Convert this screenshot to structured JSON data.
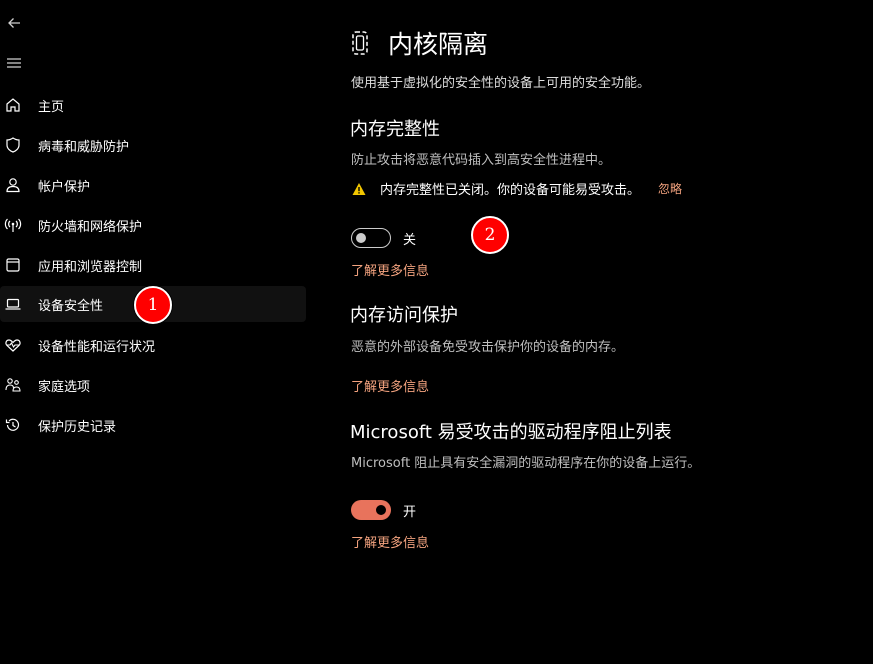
{
  "sidebar": {
    "back_icon": "back-arrow-icon",
    "menu_icon": "hamburger-menu-icon",
    "items": [
      {
        "label": "主页",
        "icon": "home-icon"
      },
      {
        "label": "病毒和威胁防护",
        "icon": "shield-icon"
      },
      {
        "label": "帐户保护",
        "icon": "person-icon"
      },
      {
        "label": "防火墙和网络保护",
        "icon": "wireless-signal-icon"
      },
      {
        "label": "应用和浏览器控制",
        "icon": "app-window-icon"
      },
      {
        "label": "设备安全性",
        "icon": "laptop-icon",
        "selected": true
      },
      {
        "label": "设备性能和运行状况",
        "icon": "heart-pulse-icon"
      },
      {
        "label": "家庭选项",
        "icon": "family-icon"
      },
      {
        "label": "保护历史记录",
        "icon": "history-clock-icon"
      }
    ]
  },
  "annotations": {
    "badge_1": "1",
    "badge_2": "2"
  },
  "main": {
    "title_icon": "core-isolation-chip-icon",
    "title": "内核隔离",
    "subtitle": "使用基于虚拟化的安全性的设备上可用的安全功能。",
    "memory_integrity": {
      "title": "内存完整性",
      "description": "防止攻击将恶意代码插入到高安全性进程中。",
      "warning_icon": "warning-triangle-icon",
      "warning": "内存完整性已关闭。你的设备可能易受攻击。",
      "ignore": "忽略",
      "toggle_state": "off",
      "toggle_label": "关",
      "learn_more": "了解更多信息"
    },
    "memory_access": {
      "title": "内存访问保护",
      "description": "恶意的外部设备免受攻击保护你的设备的内存。",
      "learn_more": "了解更多信息"
    },
    "driver_blocklist": {
      "title": "Microsoft 易受攻击的驱动程序阻止列表",
      "description": "Microsoft 阻止具有安全漏洞的驱动程序在你的设备上运行。",
      "toggle_state": "on",
      "toggle_label": "开",
      "learn_more": "了解更多信息"
    }
  },
  "colors": {
    "accent": "#e8735c",
    "link": "#f4a37f",
    "warning": "#f2c600",
    "badge": "#ff0000"
  }
}
